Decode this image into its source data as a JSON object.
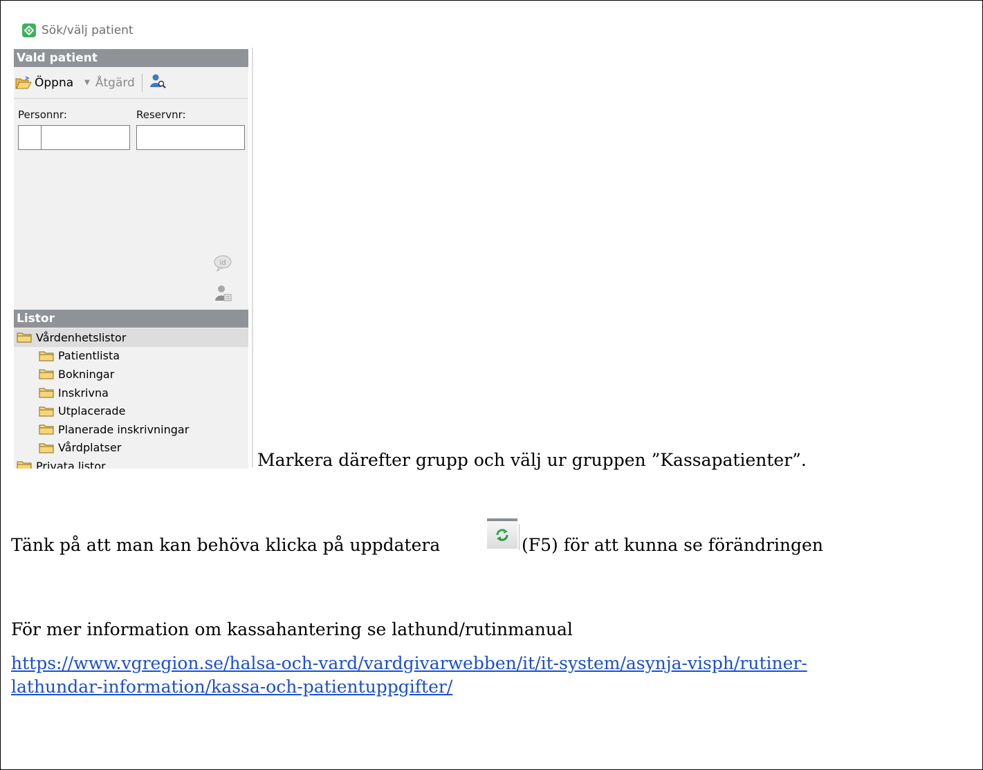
{
  "app": {
    "title": "Sök/välj patient"
  },
  "patient_panel": {
    "section_title": "Vald patient",
    "open_label": "Öppna",
    "action_label": "Åtgärd",
    "personnr_label": "Personnr:",
    "reservnr_label": "Reservnr:",
    "personnr_value": "",
    "reservnr_value": ""
  },
  "lists": {
    "section_title": "Listor",
    "root": "Vårdenhetslistor",
    "items": [
      "Patientlista",
      "Bokningar",
      "Inskrivna",
      "Utplacerade",
      "Planerade inskrivningar",
      "Vårdplatser"
    ],
    "next_root": "Privata listor"
  },
  "doc": {
    "line1": "Markera därefter grupp och välj ur gruppen ”Kassapatienter”.",
    "line2_before": "Tänk på att man kan behöva klicka på uppdatera",
    "line2_after": "(F5) för att kunna se förändringen",
    "line3": "För mer information om kassahantering se lathund/rutinmanual",
    "link_line1": "https://www.vgregion.se/halsa-och-vard/vardgivarwebben/it/it-system/asynja-visph/rutiner-",
    "link_line2": "lathundar-information/kassa-och-patientuppgifter/"
  },
  "colors": {
    "section_header": "#8f9397",
    "panel_bg": "#f1f1f1",
    "link": "#1a4fcc",
    "logo_green": "#3bb25a",
    "refresh_green": "#34a853"
  }
}
